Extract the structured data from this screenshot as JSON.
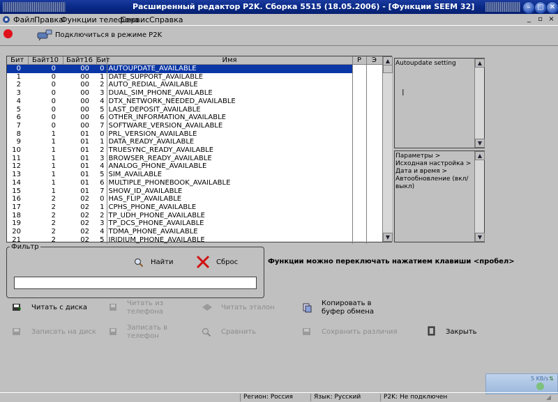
{
  "window": {
    "title": "Расширенный редактор P2K. Сборка 5515 (18.05.2006) - [Функции SEEM 32]"
  },
  "menu": [
    "Файл",
    "Правка",
    "Функции телефона",
    "Сервис",
    "Справка"
  ],
  "toolbar": {
    "connect_label": "Подключиться в режиме P2K",
    "status_color": "#e0111b"
  },
  "table": {
    "columns": [
      "Бит",
      "Байт10",
      "Байт16",
      "Бит",
      "Имя",
      "P",
      "Э"
    ],
    "rows": [
      [
        "0",
        "0",
        "00",
        "0",
        "AUTOUPDATE_AVAILABLE"
      ],
      [
        "1",
        "0",
        "00",
        "1",
        "DATE_SUPPORT_AVAILABLE"
      ],
      [
        "2",
        "0",
        "00",
        "2",
        "AUTO_REDIAL_AVAILABLE"
      ],
      [
        "3",
        "0",
        "00",
        "3",
        "DUAL_SIM_PHONE_AVAILABLE"
      ],
      [
        "4",
        "0",
        "00",
        "4",
        "DTX_NETWORK_NEEDED_AVAILABLE"
      ],
      [
        "5",
        "0",
        "00",
        "5",
        "LAST_DEPOSIT_AVAILABLE"
      ],
      [
        "6",
        "0",
        "00",
        "6",
        "OTHER_INFORMATION_AVAILABLE"
      ],
      [
        "7",
        "0",
        "00",
        "7",
        "SOFTWARE_VERSION_AVAILABLE"
      ],
      [
        "8",
        "1",
        "01",
        "0",
        "PRL_VERSION_AVAILABLE"
      ],
      [
        "9",
        "1",
        "01",
        "1",
        "DATA_READY_AVAILABLE"
      ],
      [
        "10",
        "1",
        "01",
        "2",
        "TRUESYNC_READY_AVAILABLE"
      ],
      [
        "11",
        "1",
        "01",
        "3",
        "BROWSER_READY_AVAILABLE"
      ],
      [
        "12",
        "1",
        "01",
        "4",
        "ANALOG_PHONE_AVAILABLE"
      ],
      [
        "13",
        "1",
        "01",
        "5",
        "SIM_AVAILABLE"
      ],
      [
        "14",
        "1",
        "01",
        "6",
        "MULTIPLE_PHONEBOOK_AVAILABLE"
      ],
      [
        "15",
        "1",
        "01",
        "7",
        "SHOW_ID_AVAILABLE"
      ],
      [
        "16",
        "2",
        "02",
        "0",
        "HAS_FLIP_AVAILABLE"
      ],
      [
        "17",
        "2",
        "02",
        "1",
        "CPHS_PHONE_AVAILABLE"
      ],
      [
        "18",
        "2",
        "02",
        "2",
        "TP_UDH_PHONE_AVAILABLE"
      ],
      [
        "19",
        "2",
        "02",
        "3",
        "TP_DCS_PHONE_AVAILABLE"
      ],
      [
        "20",
        "2",
        "02",
        "4",
        "TDMA_PHONE_AVAILABLE"
      ],
      [
        "21",
        "2",
        "02",
        "5",
        "IRIDIUM_PHONE_AVAILABLE"
      ]
    ]
  },
  "description": {
    "text": "Autoupdate setting"
  },
  "path": {
    "text": "Параметры > Исходная настройка > Дата и время > Автообновление (вкл/выкл)"
  },
  "filter": {
    "legend": "Фильтр",
    "find_label": "Найти",
    "reset_label": "Сброс",
    "input_value": ""
  },
  "hint": "Функции можно переключать нажатием клавиши <пробел>",
  "actions": {
    "read_disk": "Читать с диска",
    "read_phone": "Читать из телефона",
    "read_standard": "Читать эталон",
    "copy_clipboard": "Копировать в буфер обмена",
    "write_disk": "Записать на диск",
    "write_phone": "Записать в телефон",
    "compare": "Сравнить",
    "save_diff": "Сохранить различия",
    "close": "Закрыть"
  },
  "network_widget": {
    "speed": "5 KB/s"
  },
  "status": {
    "region": "Регион: Россия",
    "language": "Язык: Русский",
    "p2k": "P2K: Не подключен"
  }
}
